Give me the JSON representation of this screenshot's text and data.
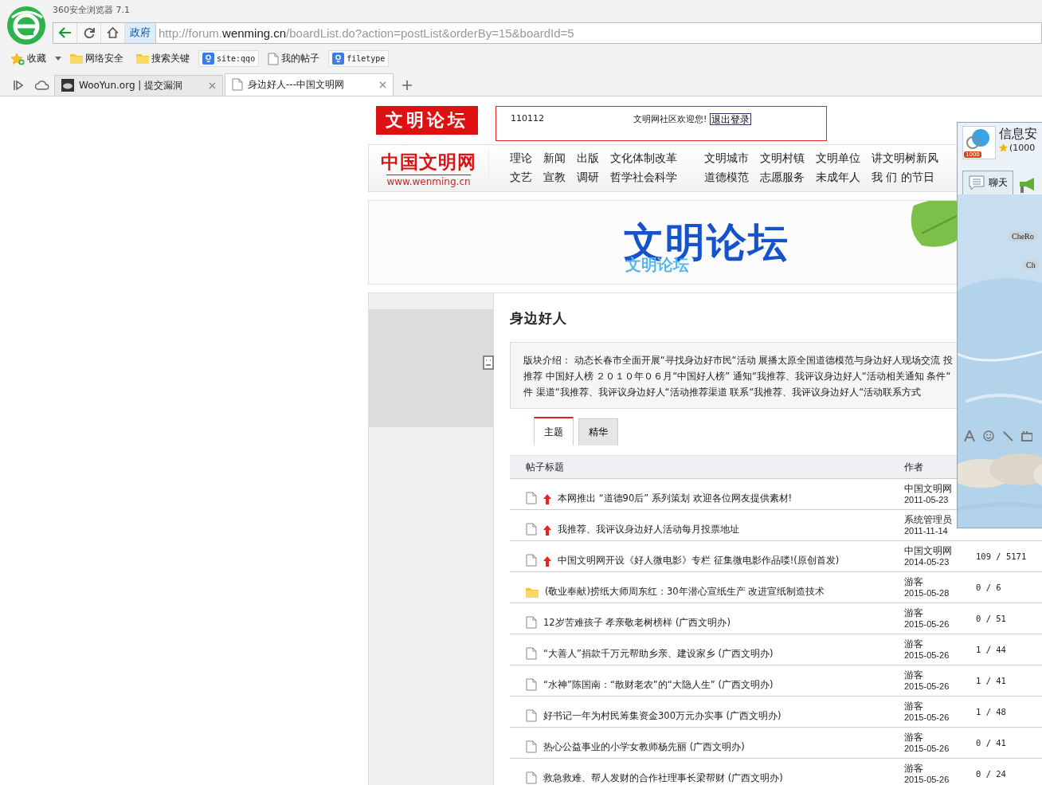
{
  "browser": {
    "app_title": "360安全浏览器 7.1",
    "address": {
      "badge": "政府",
      "url_prefix": "http://forum.",
      "url_domain": "wenming.cn",
      "url_rest": "/boardList.do?action=postList&orderBy=15&boardId=5"
    },
    "bookmarks": [
      {
        "kind": "favorites",
        "label": "收藏"
      },
      {
        "kind": "folder",
        "label": "网络安全"
      },
      {
        "kind": "folder",
        "label": "搜索关键"
      },
      {
        "kind": "search",
        "label": "site:qqo"
      },
      {
        "kind": "page",
        "label": "我的帖子"
      },
      {
        "kind": "search",
        "label": "filetype"
      }
    ],
    "tabs": [
      {
        "label": "WooYun.org | 提交漏洞",
        "selected": false
      },
      {
        "label": "身边好人---中国文明网",
        "selected": true
      }
    ]
  },
  "site": {
    "forum_logo": "文明论坛",
    "site_name": "中国文明网",
    "site_url": "www.wenming.cn",
    "user_id": "110112",
    "welcome": "文明网社区欢迎您!",
    "logout": "退出登录",
    "nav": [
      [
        "理论",
        "新闻",
        "出版",
        "文化体制改革",
        "文明城市",
        "文明村镇",
        "文明单位",
        "讲文明树新风"
      ],
      [
        "文艺",
        "宣教",
        "调研",
        "哲学社会科学",
        "道德模范",
        "志愿服务",
        "未成年人",
        "我 们 的节日"
      ]
    ]
  },
  "banner": {
    "title": "文明论坛",
    "subtitle": "文明论坛"
  },
  "board": {
    "title": "身边好人",
    "intro": [
      "版块介绍： 动态长春市全面开展“寻找身边好市民“活动 展播太原全国道德模范与身边好人现场交流 投",
      "推荐 中国好人榜 ２０１０年０６月“中国好人榜” 通知“我推荐、我评议身边好人“活动相关通知 条件“",
      "件 渠道“我推荐、我评议身边好人“活动推荐渠道 联系“我推荐、我评议身边好人“活动联系方式"
    ],
    "tabs": [
      {
        "label": "主题",
        "selected": true
      },
      {
        "label": "精华",
        "selected": false
      }
    ],
    "columns": [
      "帖子标题",
      "作者"
    ],
    "rows": [
      {
        "kind": "normal",
        "pinned": true,
        "title": "本网推出 “道德90后” 系列策划 欢迎各位网友提供素材!",
        "author": "中国文明网",
        "date": "2011-05-23"
      },
      {
        "kind": "normal",
        "pinned": true,
        "title": "我推荐、我评议身边好人活动每月投票地址",
        "author": "系统管理员",
        "date": "2011-11-14"
      },
      {
        "kind": "normal",
        "pinned": true,
        "title": "中国文明网开设《好人微电影》专栏 征集微电影作品喽!(原创首发)",
        "author": "中国文明网",
        "date": "2014-05-23",
        "stats": "109 / 5171"
      },
      {
        "kind": "hot",
        "pinned": false,
        "title": "(敬业奉献)捞纸大师周东红：30年潜心宣纸生产 改进宣纸制造技术",
        "author": "游客",
        "date": "2015-05-28",
        "stats": "0 / 6"
      },
      {
        "kind": "normal",
        "pinned": false,
        "title": "12岁苦难孩子 孝亲敬老树榜样 (广西文明办)",
        "author": "游客",
        "date": "2015-05-26",
        "stats": "0 / 51"
      },
      {
        "kind": "normal",
        "pinned": false,
        "title": "“大善人”捐款千万元帮助乡亲、建设家乡 (广西文明办)",
        "author": "游客",
        "date": "2015-05-26",
        "stats": "1 / 44"
      },
      {
        "kind": "normal",
        "pinned": false,
        "title": "“水神”陈国南：“散财老农”的“大隐人生” (广西文明办)",
        "author": "游客",
        "date": "2015-05-26",
        "stats": "1 / 41"
      },
      {
        "kind": "normal",
        "pinned": false,
        "title": "好书记一年为村民筹集资金300万元办实事 (广西文明办)",
        "author": "游客",
        "date": "2015-05-26",
        "stats": "1 / 48"
      },
      {
        "kind": "normal",
        "pinned": false,
        "title": "热心公益事业的小学女教师杨先丽 (广西文明办)",
        "author": "游客",
        "date": "2015-05-26",
        "stats": "0 / 41"
      },
      {
        "kind": "normal",
        "pinned": false,
        "title": "救急救难、帮人发财的合作社理事长梁帮财 (广西文明办)",
        "author": "游客",
        "date": "2015-05-26",
        "stats": "0 / 24"
      }
    ]
  },
  "chat": {
    "group_name": "信息安",
    "member_count": "(1000",
    "badge": "1000",
    "tab": "聊天",
    "messages": [
      "CheRo",
      "Ch"
    ]
  }
}
